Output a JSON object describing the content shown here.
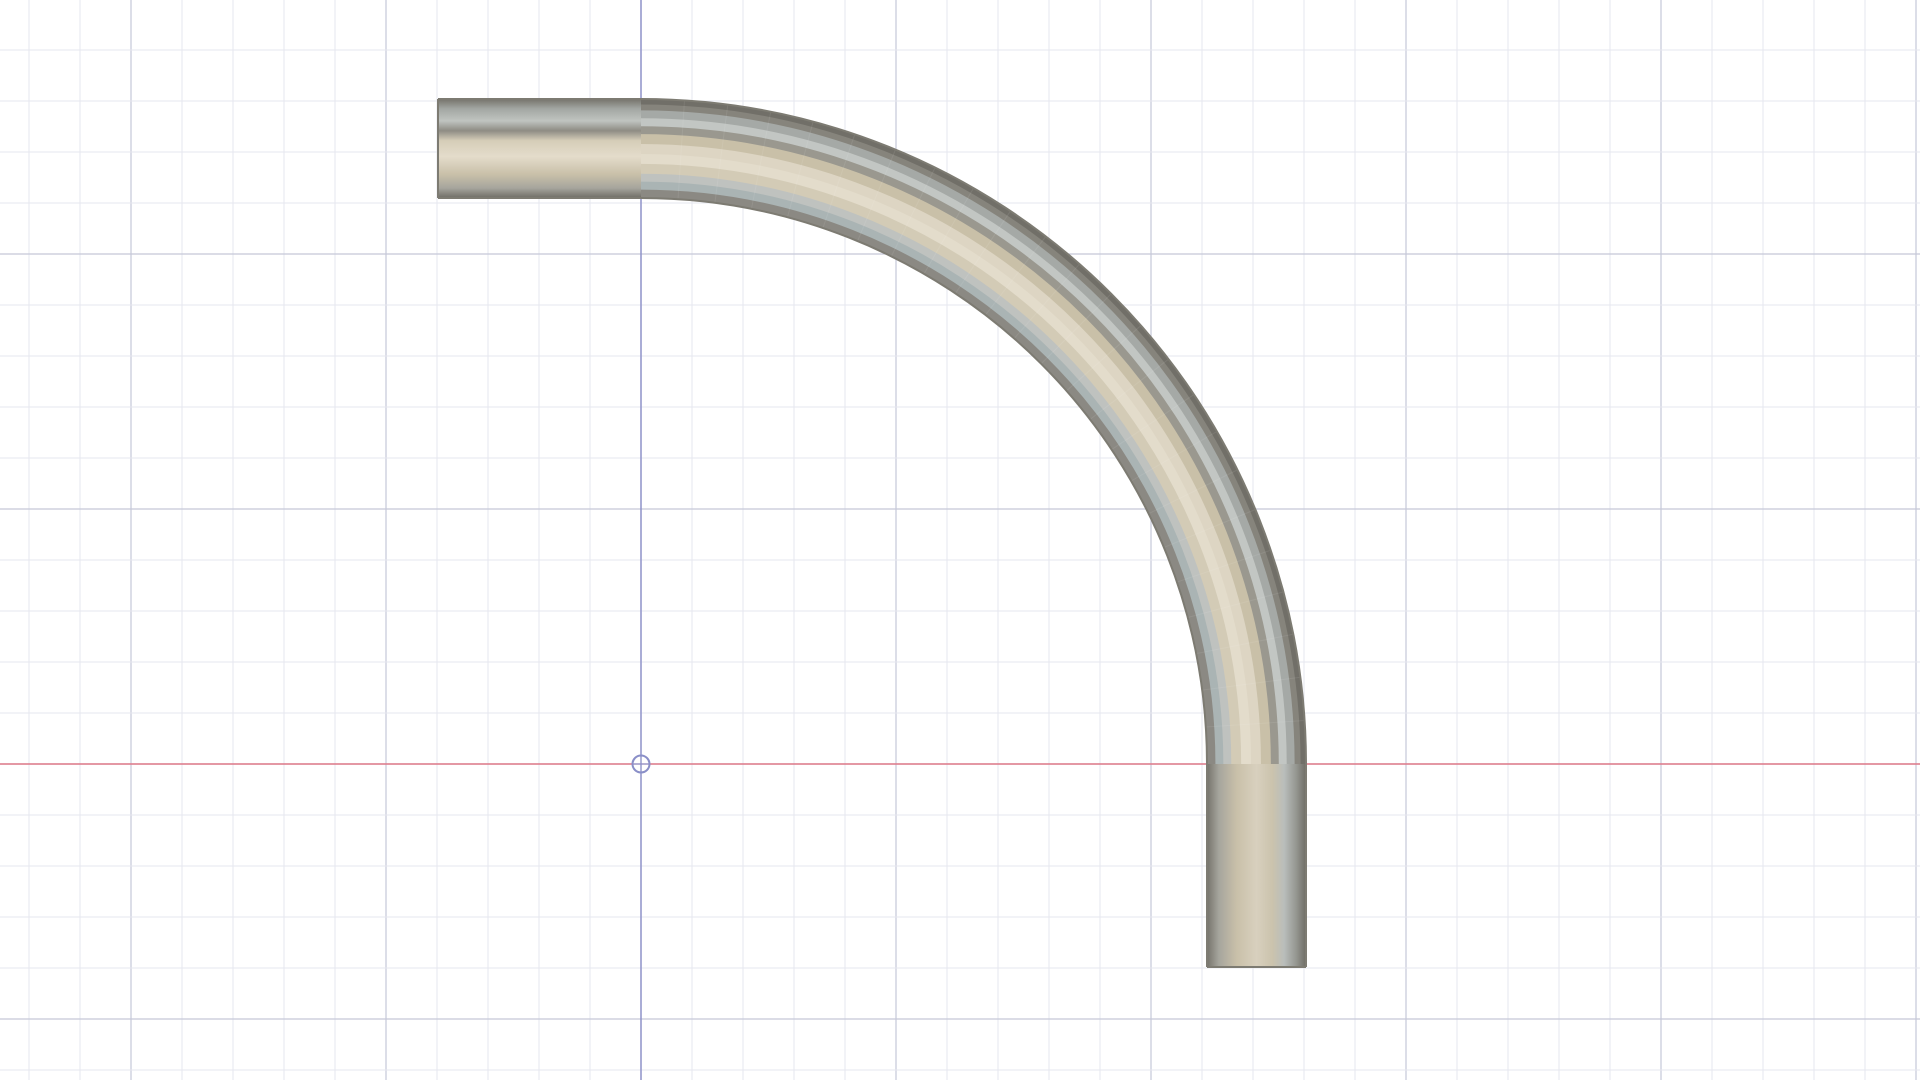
{
  "app": {
    "view": "top"
  },
  "canvas": {
    "background": "#ffffff",
    "grid_enabled": true,
    "colors": {
      "grid_minor": "#e6e7ef",
      "grid_major": "#c5c7d8",
      "axis_vertical": "#8a8fc8",
      "axis_horizontal": "#e07a8a",
      "origin_marker": "#8a8fc8"
    }
  },
  "model": {
    "object": "bent-tube",
    "bend_angle_deg": 90,
    "colors": {
      "tube_edge": "#7d7b72",
      "tube_body": "#c9c0a8",
      "tube_highlight": "#e3dccb",
      "tube_reflection": "#aab4b4"
    }
  }
}
